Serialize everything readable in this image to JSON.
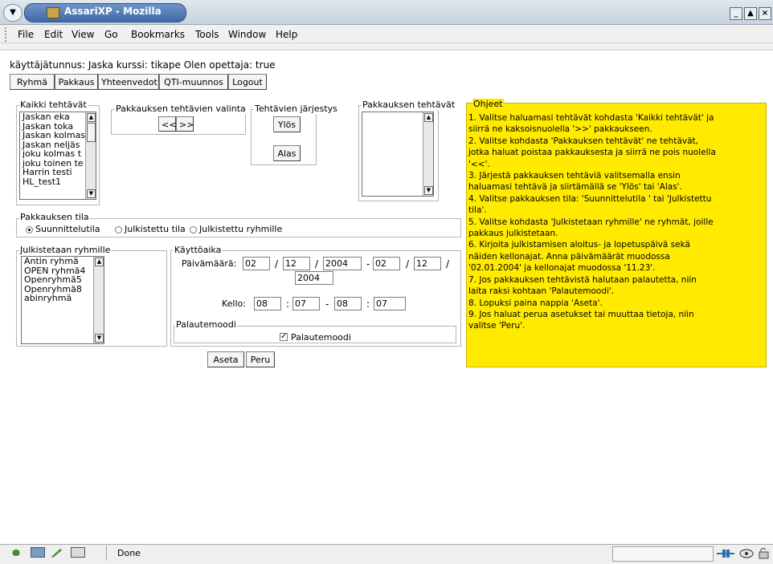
{
  "window": {
    "title": "AssariXP - Mozilla",
    "colors": {
      "titlebar": "#c8d3de",
      "title_pill": "#3f6aa8",
      "help_bg": "#ffea00"
    }
  },
  "menubar": {
    "items": [
      "File",
      "Edit",
      "View",
      "Go",
      "Bookmarks",
      "Tools",
      "Window",
      "Help"
    ]
  },
  "header": {
    "user_line": "käyttäjätunnus: Jaska kurssi: tikape Olen opettaja: true"
  },
  "nav": {
    "buttons": [
      "Ryhmä",
      "Pakkaus",
      "Yhteenvedot",
      "QTI-muunnos",
      "Logout"
    ]
  },
  "all_tasks": {
    "legend": "Kaikki tehtävät",
    "items": [
      "Jaskan eka",
      "Jaskan toka",
      "Jaskan kolmas",
      "Jaskan neljäs",
      "joku kolmas t",
      "joku toinen te",
      "Harrin testi",
      "HL_test1"
    ]
  },
  "selection": {
    "legend": "Pakkauksen tehtävien valinta",
    "left_label": "<<",
    "right_label": ">>"
  },
  "order": {
    "legend": "Tehtävien järjestys",
    "up_label": "Ylös",
    "down_label": "Alas"
  },
  "package_tasks": {
    "legend": "Pakkauksen tehtävät"
  },
  "state": {
    "legend": "Pakkauksen tila",
    "options": [
      "Suunnittelutila",
      "Julkistettu tila",
      "Julkistettu ryhmille"
    ],
    "selected": "Suunnittelutila"
  },
  "groups": {
    "legend": "Julkistetaan ryhmille",
    "items": [
      "Antin ryhmä",
      "OPEN ryhmä4",
      "Openryhmä5",
      "Openryhmä8",
      "abinryhmä"
    ]
  },
  "usage": {
    "legend": "Käyttöaika",
    "date_label": "Päivämäärä:",
    "start_day": "02",
    "start_month": "12",
    "start_year": "2004",
    "end_day": "02",
    "end_month": "12",
    "end_year": "2004",
    "slash": "/",
    "dash": "-",
    "time_label": "Kello:",
    "start_hour": "08",
    "start_min": "07",
    "end_hour": "08",
    "end_min": "07",
    "colon": ":"
  },
  "feedback": {
    "legend": "Palautemoodi",
    "label": "Palautemoodi",
    "checked": true
  },
  "actions": {
    "set_label": "Aseta",
    "cancel_label": "Peru"
  },
  "help": {
    "title": "Ohjeet",
    "lines": [
      "1. Valitse haluamasi tehtävät kohdasta 'Kaikki tehtävät' ja",
      "siirrä ne kaksoisnuolella '>>' pakkaukseen.",
      "2. Valitse kohdasta 'Pakkauksen tehtävät' ne tehtävät,",
      "jotka haluat poistaa pakkauksesta ja siirrä ne pois nuolella",
      "'<<'.",
      "3. Järjestä pakkauksen tehtäviä valitsemalla ensin",
      "haluamasi tehtävä ja siirtämällä se 'Ylös' tai 'Alas'.",
      "4. Valitse pakkauksen tila: 'Suunnittelutila ' tai 'Julkistettu",
      "tila'.",
      "5. Valitse kohdasta 'Julkistetaan ryhmille' ne ryhmät, joille",
      "pakkaus julkistetaan.",
      "6. Kirjoita julkistamisen aloitus- ja lopetuspäivä sekä",
      "näiden kellonajat. Anna päivämäärät muodossa",
      "'02.01.2004' ja kellonajat muodossa '11.23'.",
      "7. Jos pakkauksen tehtävistä halutaan palautetta, niin",
      "laita raksi kohtaan 'Palautemoodi'.",
      "8. Lopuksi paina nappia 'Aseta'.",
      "9. Jos haluat perua asetukset tai muuttaa tietoja, niin",
      "valitse 'Peru'."
    ]
  },
  "status": {
    "text": "Done",
    "check_mark": "✓",
    "close_glyph": "×"
  }
}
